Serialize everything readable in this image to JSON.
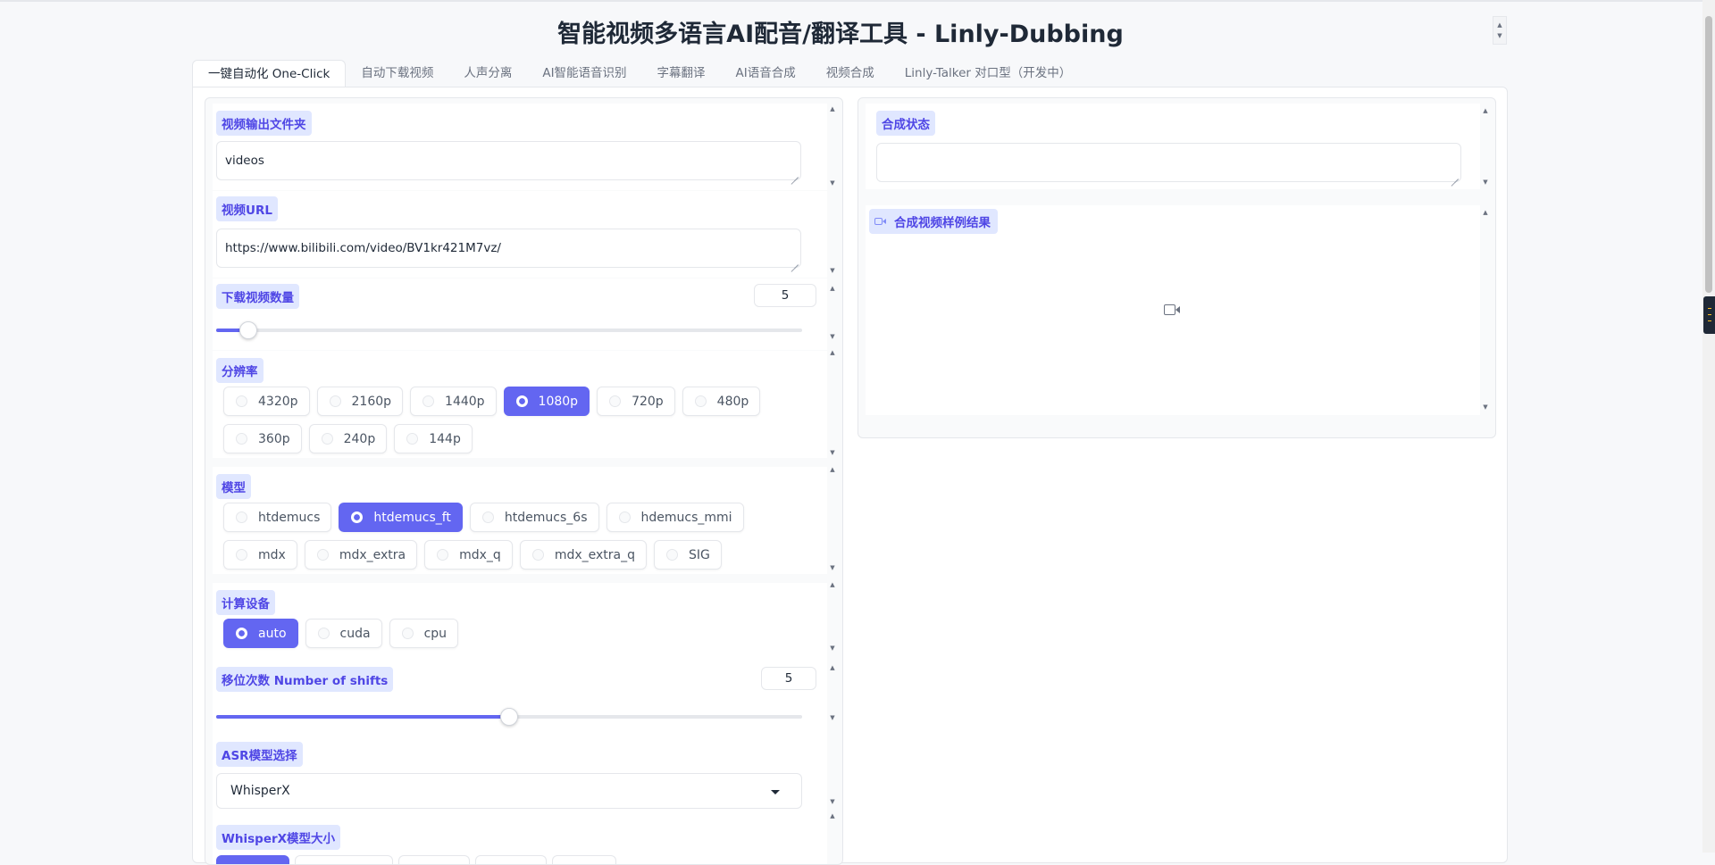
{
  "app_title": "智能视频多语言AI配音/翻译工具 - Linly-Dubbing",
  "tabs": [
    {
      "label": "一键自动化 One-Click",
      "active": true
    },
    {
      "label": "自动下载视频",
      "active": false
    },
    {
      "label": "人声分离",
      "active": false
    },
    {
      "label": "AI智能语音识别",
      "active": false
    },
    {
      "label": "字幕翻译",
      "active": false
    },
    {
      "label": "AI语音合成",
      "active": false
    },
    {
      "label": "视频合成",
      "active": false
    },
    {
      "label": "Linly-Talker 对口型（开发中）",
      "active": false
    }
  ],
  "left": {
    "output_folder": {
      "label": "视频输出文件夹",
      "value": "videos"
    },
    "video_url": {
      "label": "视频URL",
      "value": "https://www.bilibili.com/video/BV1kr421M7vz/"
    },
    "download_count": {
      "label": "下载视频数量",
      "value": "5",
      "fraction": 0.055
    },
    "resolution": {
      "label": "分辨率",
      "options": [
        "4320p",
        "2160p",
        "1440p",
        "1080p",
        "720p",
        "480p",
        "360p",
        "240p",
        "144p"
      ],
      "selected": "1080p"
    },
    "model": {
      "label": "模型",
      "options": [
        "htdemucs",
        "htdemucs_ft",
        "htdemucs_6s",
        "hdemucs_mmi",
        "mdx",
        "mdx_extra",
        "mdx_q",
        "mdx_extra_q",
        "SIG"
      ],
      "selected": "htdemucs_ft"
    },
    "device": {
      "label": "计算设备",
      "options": [
        "auto",
        "cuda",
        "cpu"
      ],
      "selected": "auto"
    },
    "shifts": {
      "label": "移位次数 Number of shifts",
      "value": "5",
      "fraction": 0.5
    },
    "asr_model": {
      "label": "ASR模型选择",
      "value": "WhisperX"
    },
    "whisperx_size": {
      "label": "WhisperX模型大小"
    }
  },
  "right": {
    "status": {
      "label": "合成状态",
      "value": ""
    },
    "result_video": {
      "label": "合成视频样例结果"
    }
  },
  "colors": {
    "accent": "#6366f1",
    "label_bg": "#e0e7ff",
    "label_text": "#4f46e5"
  }
}
